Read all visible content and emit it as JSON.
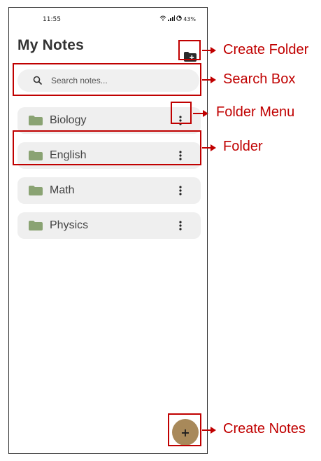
{
  "status_bar": {
    "time": "11:55",
    "battery": "43%"
  },
  "header": {
    "title": "My Notes"
  },
  "search": {
    "placeholder": "Search notes..."
  },
  "folders": [
    {
      "name": "Biology"
    },
    {
      "name": "English"
    },
    {
      "name": "Math"
    },
    {
      "name": "Physics"
    }
  ],
  "fab": {
    "label": "+"
  },
  "annotations": {
    "create_folder": "Create Folder",
    "search_box": "Search Box",
    "folder_menu": "Folder Menu",
    "folder": "Folder",
    "create_notes": "Create Notes"
  },
  "colors": {
    "annotation": "#c00000",
    "folder_icon": "#8aa373",
    "fab": "#a8895a",
    "folder_bg": "#efefef"
  }
}
